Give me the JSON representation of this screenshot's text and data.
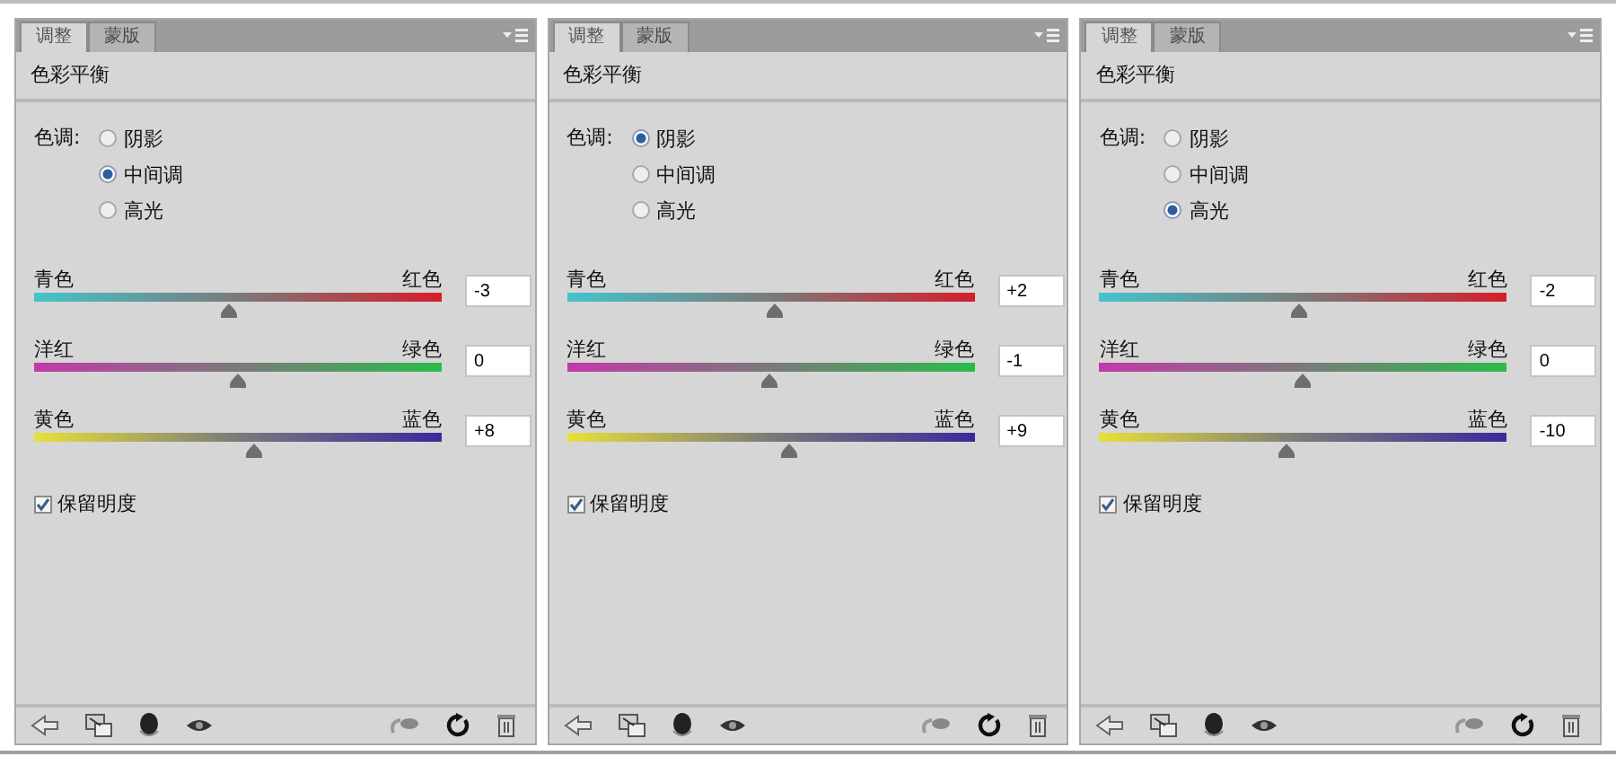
{
  "panels": [
    {
      "tabs": [
        {
          "label": "调整",
          "selected": true
        },
        {
          "label": "蒙版",
          "selected": false
        }
      ],
      "title": "色彩平衡",
      "tone": {
        "label": "色调:",
        "options": [
          {
            "label": "阴影",
            "selected": false
          },
          {
            "label": "中间调",
            "selected": true
          },
          {
            "label": "高光",
            "selected": false
          }
        ]
      },
      "sliders": [
        {
          "left": "青色",
          "right": "红色",
          "value": "-3",
          "level": 0.48
        },
        {
          "left": "洋红",
          "right": "绿色",
          "value": "0",
          "level": 0.5
        },
        {
          "left": "黄色",
          "right": "蓝色",
          "value": "+8",
          "level": 0.54
        }
      ],
      "preserve": {
        "label": "保留明度",
        "checked": true
      }
    },
    {
      "tabs": [
        {
          "label": "调整",
          "selected": true
        },
        {
          "label": "蒙版",
          "selected": false
        }
      ],
      "title": "色彩平衡",
      "tone": {
        "label": "色调:",
        "options": [
          {
            "label": "阴影",
            "selected": true
          },
          {
            "label": "中间调",
            "selected": false
          },
          {
            "label": "高光",
            "selected": false
          }
        ]
      },
      "sliders": [
        {
          "left": "青色",
          "right": "红色",
          "value": "+2",
          "level": 0.51
        },
        {
          "left": "洋红",
          "right": "绿色",
          "value": "-1",
          "level": 0.495
        },
        {
          "left": "黄色",
          "right": "蓝色",
          "value": "+9",
          "level": 0.545
        }
      ],
      "preserve": {
        "label": "保留明度",
        "checked": true
      }
    },
    {
      "tabs": [
        {
          "label": "调整",
          "selected": true
        },
        {
          "label": "蒙版",
          "selected": false
        }
      ],
      "title": "色彩平衡",
      "tone": {
        "label": "色调:",
        "options": [
          {
            "label": "阴影",
            "selected": false
          },
          {
            "label": "中间调",
            "selected": false
          },
          {
            "label": "高光",
            "selected": true
          }
        ]
      },
      "sliders": [
        {
          "left": "青色",
          "right": "红色",
          "value": "-2",
          "level": 0.49
        },
        {
          "left": "洋红",
          "right": "绿色",
          "value": "0",
          "level": 0.5
        },
        {
          "left": "黄色",
          "right": "蓝色",
          "value": "-10",
          "level": 0.46
        }
      ],
      "preserve": {
        "label": "保留明度",
        "checked": true
      }
    }
  ]
}
